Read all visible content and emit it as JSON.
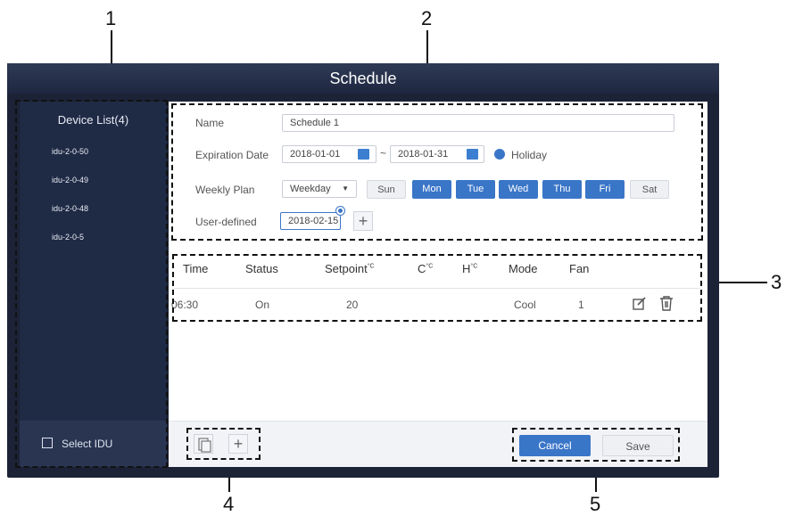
{
  "callouts": [
    "1",
    "2",
    "3",
    "4",
    "5"
  ],
  "window": {
    "title": "Schedule"
  },
  "sidebar": {
    "title": "Device List(4)",
    "items": [
      "idu-2-0-50",
      "idu-2-0-49",
      "idu-2-0-48",
      "idu-2-0-5"
    ],
    "select_label": "Select IDU"
  },
  "form": {
    "name_label": "Name",
    "name_value": "Schedule 1",
    "expiration_label": "Expiration Date",
    "start_date": "2018-01-01",
    "separator": "~",
    "end_date": "2018-01-31",
    "holiday_label": "Holiday",
    "weekly_label": "Weekly Plan",
    "weekly_value": "Weekday",
    "days": [
      {
        "label": "Sun",
        "on": false
      },
      {
        "label": "Mon",
        "on": true
      },
      {
        "label": "Tue",
        "on": true
      },
      {
        "label": "Wed",
        "on": true
      },
      {
        "label": "Thu",
        "on": true
      },
      {
        "label": "Fri",
        "on": true
      },
      {
        "label": "Sat",
        "on": false
      }
    ],
    "user_label": "User-defined",
    "user_date": "2018-02-15"
  },
  "table": {
    "headers": [
      "Time",
      "Status",
      "Setpoint",
      "C",
      "H",
      "Mode",
      "Fan"
    ],
    "unit": "°C",
    "row": {
      "time": "06:30",
      "status": "On",
      "setpoint": "20",
      "mode": "Cool",
      "fan": "1"
    }
  },
  "footer": {
    "cancel": "Cancel",
    "save": "Save"
  },
  "colors": {
    "accent": "#3a76c8",
    "frame": "#1c2337"
  }
}
